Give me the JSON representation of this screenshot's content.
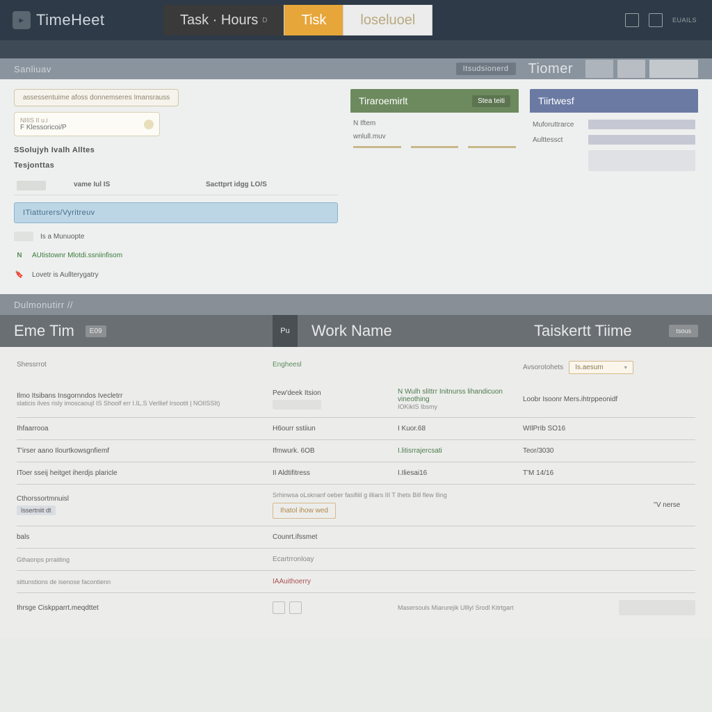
{
  "app": {
    "name": "TimeHeet"
  },
  "tabs": {
    "main": {
      "label": "Task · Hours",
      "suffix": "D"
    },
    "task": {
      "label": "Tisk"
    },
    "closed": {
      "label": "loseluoel"
    }
  },
  "topIcons": {
    "label": "EUAILS"
  },
  "section1": {
    "left_label": "Sanliuav",
    "right_small": "Itsudsionerd",
    "timer_label": "Tiomer"
  },
  "upper": {
    "chip1": "assessentuime  afoss  donnemseres  Imansrauss",
    "chip2_line1": "NIIIS II  u.i",
    "chip2_line2": "F Klessoricoi/P",
    "head1": "SSolujyh Ivalh Alltes",
    "head2": "Tesjonttas",
    "col_name": "vame Iul IS",
    "col_desc": "Sacttprt idgg LO/S",
    "selected": "ITiatturers/Vyritreuv",
    "r1": "Is a Munuopte",
    "r2": "AUtistownr  Mlotdi.ssniinfisom",
    "r3": "Lovetr is  Aullterygatry"
  },
  "cards": {
    "a": {
      "title": "Tiraroemirlt",
      "btn": "Stea teiti",
      "k1": "N Iftem",
      "k2": "wnlull.muv"
    },
    "b": {
      "title": "Tiirtwesf",
      "k1": "Muforuttrarce",
      "k2": "Aulttessct"
    }
  },
  "section2": {
    "label": "Dulmonutirr //"
  },
  "bigHead": {
    "c1": "Eme Tim",
    "c1_tag": "E09",
    "c2_pre": "Pu",
    "c2": "Work Name",
    "c3": "Taiskertt Tiime",
    "c3_tag": "tsous"
  },
  "subhd": {
    "c1": "Shessrrot",
    "c2": "Engheesl",
    "c3_label": "Avsorotohets",
    "sel": "Is.aesum"
  },
  "rows": [
    {
      "c1a": "Ilmo Itsibans Insgornndos Ivecletrr",
      "c1b": "slaticis  ilves  risly  imoscaoujI IS  Shoolf  err   I.IL.S   Verllief Irsootit |  NOIISSIt)",
      "c2": "Pew'deek Itsion",
      "c2b_a": "N Wulh  slittrr Initnurss lihandicuon  vineothing",
      "c2b_b": "IOKikIS  Ibsmy",
      "c3": "Loobr Isoonr  Mers.ihtrppeonidf"
    },
    {
      "c1": "Ihfaarrooa",
      "c2": "H6ourr sstiiun",
      "c2b": "I Kuor.68",
      "c3": "WIlPrIb SO16"
    },
    {
      "c1": "T'irser aano Ilourtkowsgnfiemf",
      "c2": "Ifmwurk. 6OB",
      "c2b": "I.litisrrajercsati",
      "c2b_cls": "green",
      "c3": "Teor/3030"
    },
    {
      "c1": "IToer  sseij  heitget  iherdjs  plaricle",
      "c2": "II Aldtifitress",
      "c2b": "I.Iliesai16",
      "c3": "T'M 14/16"
    },
    {
      "c1": "Cthorssortmnuisl",
      "c1_chip": "Issertniit dt",
      "c2_btn": "Ihatol ihow wed",
      "c2_line": "Srhinwsa oLsknanf oeber fasifiiil      g illiars   III T  Ihets  Bill    flew Iling",
      "c3_sketch": true,
      "c3": "''V nerse"
    },
    {
      "c1": "bals",
      "c2": "Counrt.ifssmet",
      "c2b": "",
      "c3": ""
    },
    {
      "c1": "Gthaonps prraiiting",
      "c1_cls": "muted",
      "c2": "Ecartrronloay",
      "c2_cls": "stat",
      "c2b": "",
      "c3": ""
    },
    {
      "c1": "sittunstions de isenose facontienn",
      "c1_cls": "muted",
      "c2": "IAAuithoerry",
      "c2_cls": "red",
      "c2b": "",
      "c3": ""
    },
    {
      "c1": "Ihrsge Ciskpparrt.meqdttet",
      "c2_boxes": true,
      "c2b": "Masersouls Miarurejik Ulllyl Srodl Kitrtgart",
      "c2b_cls": "muted",
      "c3_bar": true
    }
  ]
}
